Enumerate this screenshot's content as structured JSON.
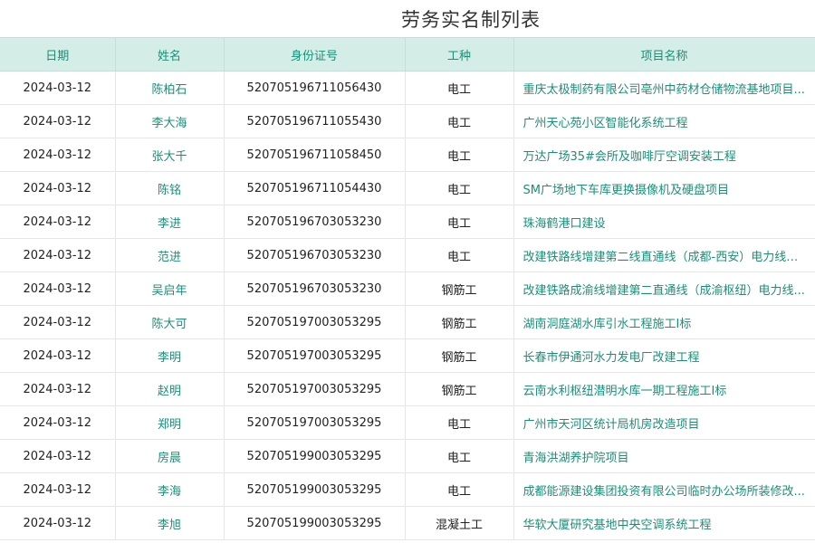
{
  "title": "劳务实名制列表",
  "colors": {
    "header_bg": "#d4ede7",
    "accent": "#1a8f78",
    "text": "#222222"
  },
  "columns": [
    "日期",
    "姓名",
    "身份证号",
    "工种",
    "项目名称"
  ],
  "rows": [
    {
      "date": "2024-03-12",
      "name": "陈柏石",
      "id": "520705196711056430",
      "type": "电工",
      "project": "重庆太极制药有限公司亳州中药材仓储物流基地项目..."
    },
    {
      "date": "2024-03-12",
      "name": "李大海",
      "id": "520705196711055430",
      "type": "电工",
      "project": "广州天心苑小区智能化系统工程"
    },
    {
      "date": "2024-03-12",
      "name": "张大千",
      "id": "520705196711058450",
      "type": "电工",
      "project": "万达广场35#会所及咖啡厅空调安装工程"
    },
    {
      "date": "2024-03-12",
      "name": "陈铭",
      "id": "520705196711054430",
      "type": "电工",
      "project": "SM广场地下车库更换摄像机及硬盘项目"
    },
    {
      "date": "2024-03-12",
      "name": "李进",
      "id": "520705196703053230",
      "type": "电工",
      "project": "珠海鹤港口建设"
    },
    {
      "date": "2024-03-12",
      "name": "范进",
      "id": "520705196703053230",
      "type": "电工",
      "project": "改建铁路线增建第二线直通线（成都-西安）电力线路..."
    },
    {
      "date": "2024-03-12",
      "name": "吴启年",
      "id": "520705196703053230",
      "type": "钢筋工",
      "project": "改建铁路成渝线增建第二直通线（成渝枢纽）电力线..."
    },
    {
      "date": "2024-03-12",
      "name": "陈大可",
      "id": "520705197003053295",
      "type": "钢筋工",
      "project": "湖南洞庭湖水库引水工程施工I标"
    },
    {
      "date": "2024-03-12",
      "name": "李明",
      "id": "520705197003053295",
      "type": "钢筋工",
      "project": "长春市伊通河水力发电厂改建工程"
    },
    {
      "date": "2024-03-12",
      "name": "赵明",
      "id": "520705197003053295",
      "type": "钢筋工",
      "project": "云南水利枢纽潜明水库一期工程施工I标"
    },
    {
      "date": "2024-03-12",
      "name": "郑明",
      "id": "520705197003053295",
      "type": "电工",
      "project": "广州市天河区统计局机房改造项目"
    },
    {
      "date": "2024-03-12",
      "name": "房晨",
      "id": "520705199003053295",
      "type": "电工",
      "project": "青海洪湖养护院项目"
    },
    {
      "date": "2024-03-12",
      "name": "李海",
      "id": "520705199003053295",
      "type": "电工",
      "project": "成都能源建设集团投资有限公司临时办公场所装修改..."
    },
    {
      "date": "2024-03-12",
      "name": "李旭",
      "id": "520705199003053295",
      "type": "混凝土工",
      "project": "华软大厦研究基地中央空调系统工程"
    }
  ]
}
